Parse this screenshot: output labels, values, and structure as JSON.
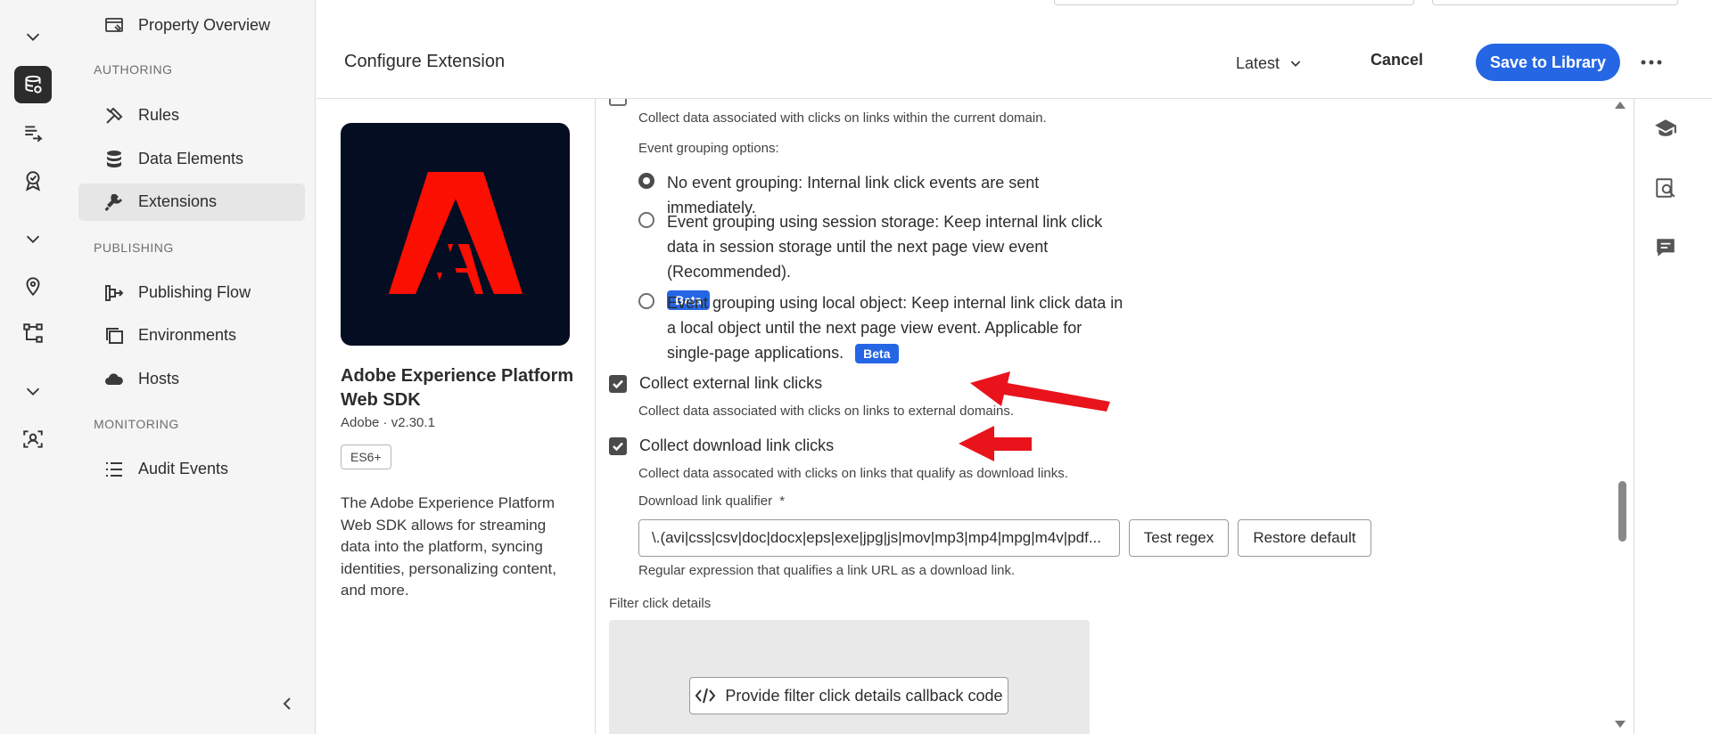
{
  "nav": {
    "property_overview": "Property Overview",
    "section_authoring": "AUTHORING",
    "rules": "Rules",
    "data_elements": "Data Elements",
    "extensions": "Extensions",
    "section_publishing": "PUBLISHING",
    "publishing_flow": "Publishing Flow",
    "environments": "Environments",
    "hosts": "Hosts",
    "section_monitoring": "MONITORING",
    "audit_events": "Audit Events"
  },
  "header": {
    "title": "Configure Extension",
    "version": "Latest",
    "cancel_label": "Cancel",
    "save_label": "Save to Library"
  },
  "extension": {
    "name": "Adobe Experience Platform Web SDK",
    "meta": "Adobe · v2.30.1",
    "badge": "ES6+",
    "description": "The Adobe Experience Platform Web SDK allows for streaming data into the platform, syncing identities, personalizing content, and more."
  },
  "settings": {
    "internal_help": "Collect data associated with clicks on links within the current domain.",
    "grouping_label": "Event grouping options:",
    "radio_none": "No event grouping: Internal link click events are sent immediately.",
    "radio_session": "Event grouping using session storage: Keep internal link click data in session storage until the next page view event (Recommended).",
    "radio_local": "Event grouping using local object: Keep internal link click data in a local object until the next page view event. Applicable for single-page applications.",
    "beta": "Beta",
    "external_label": "Collect external link clicks",
    "external_help": "Collect data associated with clicks on links to external domains.",
    "download_label": "Collect download link clicks",
    "download_help": "Collect data assocated with clicks on links that qualify as download links.",
    "qualifier_label": "Download link qualifier",
    "qualifier_required": "*",
    "qualifier_value": "\\.(avi|css|csv|doc|docx|eps|exe|jpg|js|mov|mp3|mp4|mpg|m4v|pdf...",
    "test_regex": "Test regex",
    "restore_default": "Restore default",
    "qualifier_help": "Regular expression that qualifies a link URL as a download link.",
    "filter_label": "Filter click details",
    "filter_button": "Provide filter click details callback code"
  },
  "colors": {
    "accent": "#2566e4",
    "annotation_arrow": "#e8131b",
    "adobe_red": "#fa0f00",
    "logo_bg": "#040d22"
  }
}
